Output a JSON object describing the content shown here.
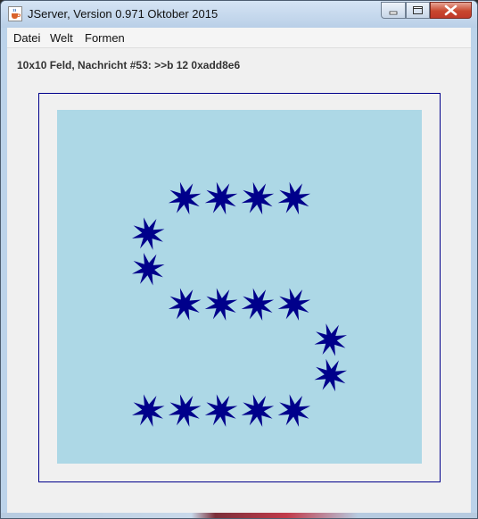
{
  "window": {
    "title": "JServer, Version 0.971 Oktober 2015"
  },
  "menu": {
    "items": [
      "Datei",
      "Welt",
      "Formen"
    ]
  },
  "status": {
    "text": "10x10 Feld, Nachricht #53: >>b 12 0xadd8e6"
  },
  "board": {
    "columns": 10,
    "rows": 10,
    "background": "#add8e6",
    "frame_color": "#00008b",
    "star_color": "#00008b",
    "stars": [
      {
        "col": 3,
        "row": 2
      },
      {
        "col": 4,
        "row": 2
      },
      {
        "col": 5,
        "row": 2
      },
      {
        "col": 6,
        "row": 2
      },
      {
        "col": 2,
        "row": 3
      },
      {
        "col": 2,
        "row": 4
      },
      {
        "col": 3,
        "row": 5
      },
      {
        "col": 4,
        "row": 5
      },
      {
        "col": 5,
        "row": 5
      },
      {
        "col": 6,
        "row": 5
      },
      {
        "col": 7,
        "row": 6
      },
      {
        "col": 7,
        "row": 7
      },
      {
        "col": 2,
        "row": 8
      },
      {
        "col": 3,
        "row": 8
      },
      {
        "col": 4,
        "row": 8
      },
      {
        "col": 5,
        "row": 8
      },
      {
        "col": 6,
        "row": 8
      }
    ]
  }
}
